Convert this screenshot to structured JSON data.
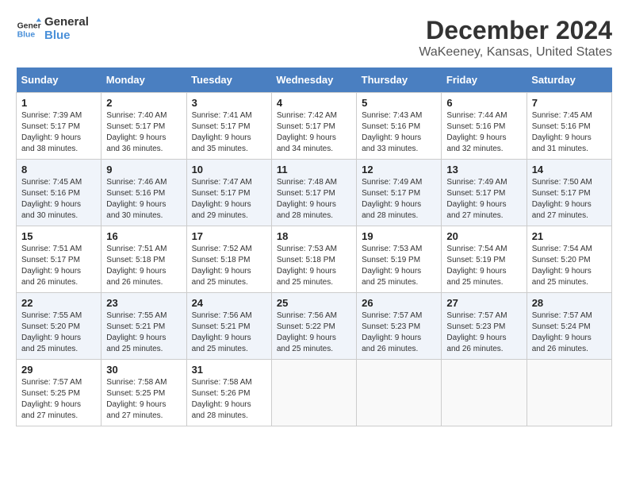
{
  "header": {
    "logo_line1": "General",
    "logo_line2": "Blue",
    "title": "December 2024",
    "location": "WaKeeney, Kansas, United States"
  },
  "columns": [
    "Sunday",
    "Monday",
    "Tuesday",
    "Wednesday",
    "Thursday",
    "Friday",
    "Saturday"
  ],
  "weeks": [
    [
      {
        "day": "1",
        "sunrise": "Sunrise: 7:39 AM",
        "sunset": "Sunset: 5:17 PM",
        "daylight": "Daylight: 9 hours and 38 minutes."
      },
      {
        "day": "2",
        "sunrise": "Sunrise: 7:40 AM",
        "sunset": "Sunset: 5:17 PM",
        "daylight": "Daylight: 9 hours and 36 minutes."
      },
      {
        "day": "3",
        "sunrise": "Sunrise: 7:41 AM",
        "sunset": "Sunset: 5:17 PM",
        "daylight": "Daylight: 9 hours and 35 minutes."
      },
      {
        "day": "4",
        "sunrise": "Sunrise: 7:42 AM",
        "sunset": "Sunset: 5:17 PM",
        "daylight": "Daylight: 9 hours and 34 minutes."
      },
      {
        "day": "5",
        "sunrise": "Sunrise: 7:43 AM",
        "sunset": "Sunset: 5:16 PM",
        "daylight": "Daylight: 9 hours and 33 minutes."
      },
      {
        "day": "6",
        "sunrise": "Sunrise: 7:44 AM",
        "sunset": "Sunset: 5:16 PM",
        "daylight": "Daylight: 9 hours and 32 minutes."
      },
      {
        "day": "7",
        "sunrise": "Sunrise: 7:45 AM",
        "sunset": "Sunset: 5:16 PM",
        "daylight": "Daylight: 9 hours and 31 minutes."
      }
    ],
    [
      {
        "day": "8",
        "sunrise": "Sunrise: 7:45 AM",
        "sunset": "Sunset: 5:16 PM",
        "daylight": "Daylight: 9 hours and 30 minutes."
      },
      {
        "day": "9",
        "sunrise": "Sunrise: 7:46 AM",
        "sunset": "Sunset: 5:16 PM",
        "daylight": "Daylight: 9 hours and 30 minutes."
      },
      {
        "day": "10",
        "sunrise": "Sunrise: 7:47 AM",
        "sunset": "Sunset: 5:17 PM",
        "daylight": "Daylight: 9 hours and 29 minutes."
      },
      {
        "day": "11",
        "sunrise": "Sunrise: 7:48 AM",
        "sunset": "Sunset: 5:17 PM",
        "daylight": "Daylight: 9 hours and 28 minutes."
      },
      {
        "day": "12",
        "sunrise": "Sunrise: 7:49 AM",
        "sunset": "Sunset: 5:17 PM",
        "daylight": "Daylight: 9 hours and 28 minutes."
      },
      {
        "day": "13",
        "sunrise": "Sunrise: 7:49 AM",
        "sunset": "Sunset: 5:17 PM",
        "daylight": "Daylight: 9 hours and 27 minutes."
      },
      {
        "day": "14",
        "sunrise": "Sunrise: 7:50 AM",
        "sunset": "Sunset: 5:17 PM",
        "daylight": "Daylight: 9 hours and 27 minutes."
      }
    ],
    [
      {
        "day": "15",
        "sunrise": "Sunrise: 7:51 AM",
        "sunset": "Sunset: 5:17 PM",
        "daylight": "Daylight: 9 hours and 26 minutes."
      },
      {
        "day": "16",
        "sunrise": "Sunrise: 7:51 AM",
        "sunset": "Sunset: 5:18 PM",
        "daylight": "Daylight: 9 hours and 26 minutes."
      },
      {
        "day": "17",
        "sunrise": "Sunrise: 7:52 AM",
        "sunset": "Sunset: 5:18 PM",
        "daylight": "Daylight: 9 hours and 25 minutes."
      },
      {
        "day": "18",
        "sunrise": "Sunrise: 7:53 AM",
        "sunset": "Sunset: 5:18 PM",
        "daylight": "Daylight: 9 hours and 25 minutes."
      },
      {
        "day": "19",
        "sunrise": "Sunrise: 7:53 AM",
        "sunset": "Sunset: 5:19 PM",
        "daylight": "Daylight: 9 hours and 25 minutes."
      },
      {
        "day": "20",
        "sunrise": "Sunrise: 7:54 AM",
        "sunset": "Sunset: 5:19 PM",
        "daylight": "Daylight: 9 hours and 25 minutes."
      },
      {
        "day": "21",
        "sunrise": "Sunrise: 7:54 AM",
        "sunset": "Sunset: 5:20 PM",
        "daylight": "Daylight: 9 hours and 25 minutes."
      }
    ],
    [
      {
        "day": "22",
        "sunrise": "Sunrise: 7:55 AM",
        "sunset": "Sunset: 5:20 PM",
        "daylight": "Daylight: 9 hours and 25 minutes."
      },
      {
        "day": "23",
        "sunrise": "Sunrise: 7:55 AM",
        "sunset": "Sunset: 5:21 PM",
        "daylight": "Daylight: 9 hours and 25 minutes."
      },
      {
        "day": "24",
        "sunrise": "Sunrise: 7:56 AM",
        "sunset": "Sunset: 5:21 PM",
        "daylight": "Daylight: 9 hours and 25 minutes."
      },
      {
        "day": "25",
        "sunrise": "Sunrise: 7:56 AM",
        "sunset": "Sunset: 5:22 PM",
        "daylight": "Daylight: 9 hours and 25 minutes."
      },
      {
        "day": "26",
        "sunrise": "Sunrise: 7:57 AM",
        "sunset": "Sunset: 5:23 PM",
        "daylight": "Daylight: 9 hours and 26 minutes."
      },
      {
        "day": "27",
        "sunrise": "Sunrise: 7:57 AM",
        "sunset": "Sunset: 5:23 PM",
        "daylight": "Daylight: 9 hours and 26 minutes."
      },
      {
        "day": "28",
        "sunrise": "Sunrise: 7:57 AM",
        "sunset": "Sunset: 5:24 PM",
        "daylight": "Daylight: 9 hours and 26 minutes."
      }
    ],
    [
      {
        "day": "29",
        "sunrise": "Sunrise: 7:57 AM",
        "sunset": "Sunset: 5:25 PM",
        "daylight": "Daylight: 9 hours and 27 minutes."
      },
      {
        "day": "30",
        "sunrise": "Sunrise: 7:58 AM",
        "sunset": "Sunset: 5:25 PM",
        "daylight": "Daylight: 9 hours and 27 minutes."
      },
      {
        "day": "31",
        "sunrise": "Sunrise: 7:58 AM",
        "sunset": "Sunset: 5:26 PM",
        "daylight": "Daylight: 9 hours and 28 minutes."
      },
      null,
      null,
      null,
      null
    ]
  ]
}
